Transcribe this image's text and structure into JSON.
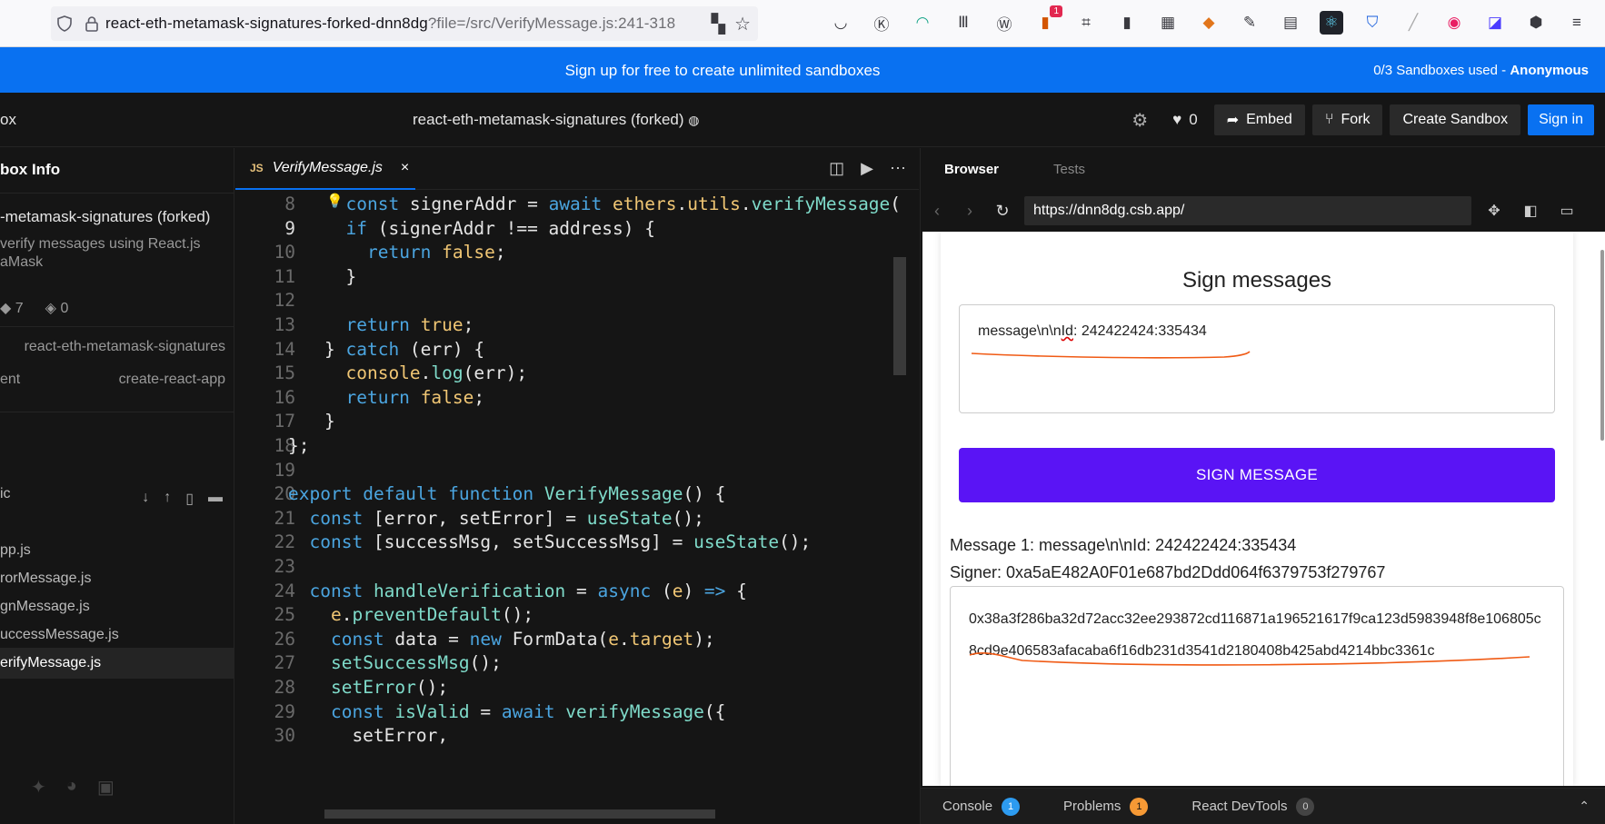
{
  "browser": {
    "url_prefix": "react-eth-metamask-signatures-forked-dnn8dg",
    "url_rest": "?file=/src/VerifyMessage.js:241-318",
    "notification_count": "1"
  },
  "banner": {
    "message": "Sign up for free to create unlimited sandboxes",
    "usage": "0/3 Sandboxes used - ",
    "usage_user": "Anonymous"
  },
  "header": {
    "left_text": "ox",
    "title": "react-eth-metamask-signatures (forked)",
    "likes": "0",
    "embed_label": "Embed",
    "fork_label": "Fork",
    "create_label": "Create Sandbox",
    "signin_label": "Sign in"
  },
  "sidebar": {
    "heading": "box Info",
    "name": "-metamask-signatures (forked)",
    "desc_line1": "verify messages using React.js",
    "desc_line2": "aMask",
    "views": "7",
    "forks": "0",
    "forked_from": "react-eth-metamask-signatures",
    "env_label": "ent",
    "env_value": "create-react-app",
    "folder": "ic",
    "files": [
      "pp.js",
      "rorMessage.js",
      "gnMessage.js",
      "uccessMessage.js",
      "erifyMessage.js"
    ]
  },
  "editor": {
    "tab_badge": "JS",
    "tab_name": "VerifyMessage.js",
    "close": "×"
  },
  "preview": {
    "tab_browser": "Browser",
    "tab_tests": "Tests",
    "address": "https://dnn8dg.csb.app/",
    "heading": "Sign messages",
    "textarea_pre": "message\\n\\n",
    "textarea_squiggle": "Id",
    "textarea_post": ": 242422424:335434",
    "button": "SIGN MESSAGE",
    "result_message": "Message 1: message\\n\\nId: 242422424:335434",
    "result_signer": "Signer: 0xa5aE482A0F01e687bd2Ddd064f6379753f279767",
    "signature": "0x38a3f286ba32d72acc32ee293872cd116871a196521617f9ca123d5983948f8e106805c8cd9e406583afacaba6f16db231d3541d2180408b425abd4214bbc3361c"
  },
  "devtools": {
    "console": "Console",
    "console_count": "1",
    "problems": "Problems",
    "problems_count": "1",
    "react": "React DevTools",
    "react_count": "0"
  },
  "colors": {
    "accent_blue": "#0971f1",
    "sign_button": "#5a14f5",
    "annotation_orange": "#f05a14"
  }
}
